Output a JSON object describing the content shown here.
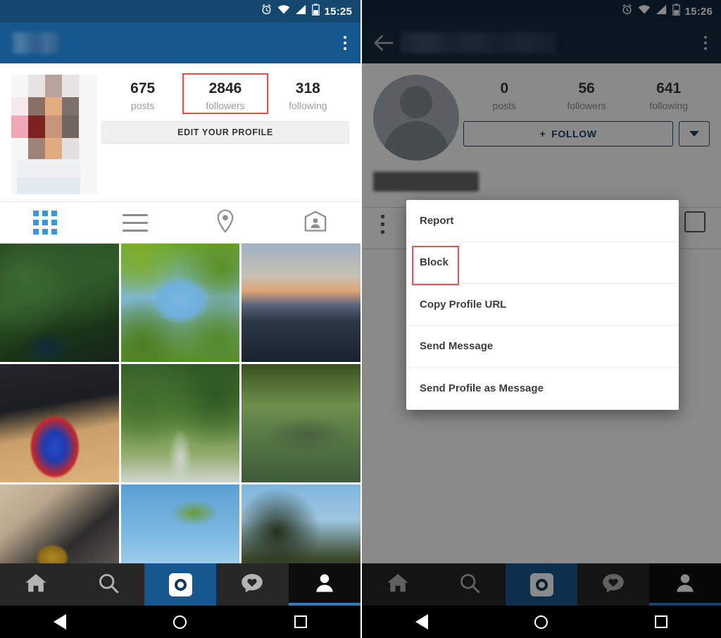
{
  "left_screen": {
    "status_bar": {
      "time": "15:25",
      "icons": [
        "alarm-icon",
        "wifi-icon",
        "signal-icon",
        "battery-icon"
      ]
    },
    "app_bar": {
      "title_redacted": "",
      "overflow_menu_label": "more-options"
    },
    "profile": {
      "avatar_label": "profile-photo-pixelated",
      "stats": [
        {
          "count": "675",
          "label": "posts",
          "highlighted": false
        },
        {
          "count": "2846",
          "label": "followers",
          "highlighted": true
        },
        {
          "count": "318",
          "label": "following",
          "highlighted": false
        }
      ],
      "edit_button": "EDIT YOUR PROFILE"
    },
    "tabs": [
      {
        "name": "grid-view-tab",
        "icon": "grid-icon",
        "active": true
      },
      {
        "name": "list-view-tab",
        "icon": "list-icon",
        "active": false
      },
      {
        "name": "photo-map-tab",
        "icon": "location-pin-icon",
        "active": false
      },
      {
        "name": "tagged-photos-tab",
        "icon": "tagged-person-icon",
        "active": false
      }
    ],
    "photo_grid": {
      "rows": 3,
      "columns": 3,
      "cells": [
        "ivy-wall-with-bicycle",
        "green-leaves-against-blue-sky",
        "river-at-dusk-with-buildings",
        "colorful-computer-mouse-with-fox-toy",
        "tree-lined-path",
        "willow-tree-over-lake",
        "hand-holding-gold-medal",
        "tree-branches-against-blue-sky",
        "bare-trees-silhouette"
      ]
    },
    "bottom_nav": [
      {
        "name": "home-tab",
        "icon": "home-icon",
        "active": false
      },
      {
        "name": "search-tab",
        "icon": "search-icon",
        "active": false
      },
      {
        "name": "camera-tab",
        "icon": "camera-icon",
        "active": true
      },
      {
        "name": "activity-tab",
        "icon": "heart-speech-bubble-icon",
        "active": false
      },
      {
        "name": "profile-tab",
        "icon": "person-icon",
        "active": true
      }
    ],
    "system_nav": [
      {
        "name": "system-back-button",
        "icon": "triangle-back-icon"
      },
      {
        "name": "system-home-button",
        "icon": "circle-home-icon"
      },
      {
        "name": "system-recents-button",
        "icon": "square-recents-icon"
      }
    ]
  },
  "right_screen": {
    "status_bar": {
      "time": "15:26",
      "icons": [
        "alarm-icon",
        "wifi-icon",
        "signal-icon",
        "battery-icon"
      ]
    },
    "app_bar": {
      "back_label": "back",
      "title_redacted": "",
      "overflow_menu_label": "more-options"
    },
    "profile": {
      "avatar_label": "default-avatar-placeholder",
      "stats": [
        {
          "count": "0",
          "label": "posts"
        },
        {
          "count": "56",
          "label": "followers"
        },
        {
          "count": "641",
          "label": "following"
        }
      ],
      "follow_button": "FOLLOW",
      "follow_plus": "+",
      "dropdown_label": "follow-options"
    },
    "dialog": {
      "items": [
        {
          "label": "Report",
          "highlighted": false
        },
        {
          "label": "Block",
          "highlighted": true
        },
        {
          "label": "Copy Profile URL",
          "highlighted": false
        },
        {
          "label": "Send Message",
          "highlighted": false
        },
        {
          "label": "Send Profile as Message",
          "highlighted": false
        }
      ]
    },
    "bottom_nav": [
      {
        "name": "home-tab",
        "icon": "home-icon",
        "active": false
      },
      {
        "name": "search-tab",
        "icon": "search-icon",
        "active": false
      },
      {
        "name": "camera-tab",
        "icon": "camera-icon",
        "active": true
      },
      {
        "name": "activity-tab",
        "icon": "heart-speech-bubble-icon",
        "active": false
      },
      {
        "name": "profile-tab",
        "icon": "person-icon",
        "active": true
      }
    ],
    "system_nav": [
      {
        "name": "system-back-button",
        "icon": "triangle-back-icon"
      },
      {
        "name": "system-home-button",
        "icon": "circle-home-icon"
      },
      {
        "name": "system-recents-button",
        "icon": "square-recents-icon"
      }
    ]
  },
  "colors": {
    "status_bar_left": "#14486F",
    "app_bar_left": "#15578F",
    "status_bar_right": "#12283C",
    "app_bar_right": "#15293D",
    "accent_blue": "#3897d8",
    "highlight_red": "#e8535a",
    "nav_dark": "#262626"
  }
}
